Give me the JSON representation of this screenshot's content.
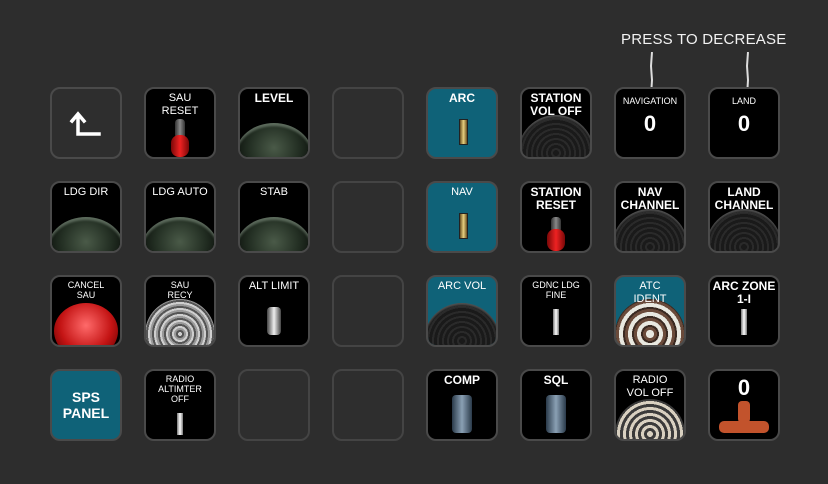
{
  "annotation": "PRESS TO DECREASE",
  "colors": {
    "background": "#2d2d2d",
    "teal_key": "#0f6278",
    "key_border": "#4a4a4a",
    "text": "#ffffff"
  },
  "keys": {
    "back": {
      "icon": "back-arrow-icon"
    },
    "sau_reset": {
      "label": "SAU\nRESET"
    },
    "level": {
      "label": "LEVEL"
    },
    "arc": {
      "label": "ARC"
    },
    "station_vol_off": {
      "label": "STATION\nVOL OFF"
    },
    "navigation": {
      "label": "NAVIGATION",
      "value": "0"
    },
    "land": {
      "label": "LAND",
      "value": "0"
    },
    "ldg_dir": {
      "label": "LDG DIR"
    },
    "ldg_auto": {
      "label": "LDG AUTO"
    },
    "stab": {
      "label": "STAB"
    },
    "nav": {
      "label": "NAV"
    },
    "station_reset": {
      "label": "STATION\nRESET"
    },
    "nav_channel": {
      "label": "NAV\nCHANNEL"
    },
    "land_channel": {
      "label": "LAND\nCHANNEL"
    },
    "cancel_sau": {
      "label": "CANCEL\nSAU"
    },
    "sau_recy": {
      "label": "SAU\nRECY"
    },
    "alt_limit": {
      "label": "ALT LIMIT"
    },
    "arc_vol": {
      "label": "ARC VOL"
    },
    "gdnc_ldg_fine": {
      "label": "GDNC LDG\nFINE"
    },
    "atc_ident": {
      "label": "ATC\nIDENT"
    },
    "arc_zone": {
      "label": "ARC ZONE\n1-I"
    },
    "sps_panel": {
      "label": "SPS\nPANEL"
    },
    "radio_altimter_off": {
      "label": "RADIO\nALTIMTER\nOFF"
    },
    "comp": {
      "label": "COMP"
    },
    "sql": {
      "label": "SQL"
    },
    "radio_vol_off": {
      "label": "RADIO\nVOL OFF"
    },
    "counter": {
      "value": "0"
    }
  }
}
